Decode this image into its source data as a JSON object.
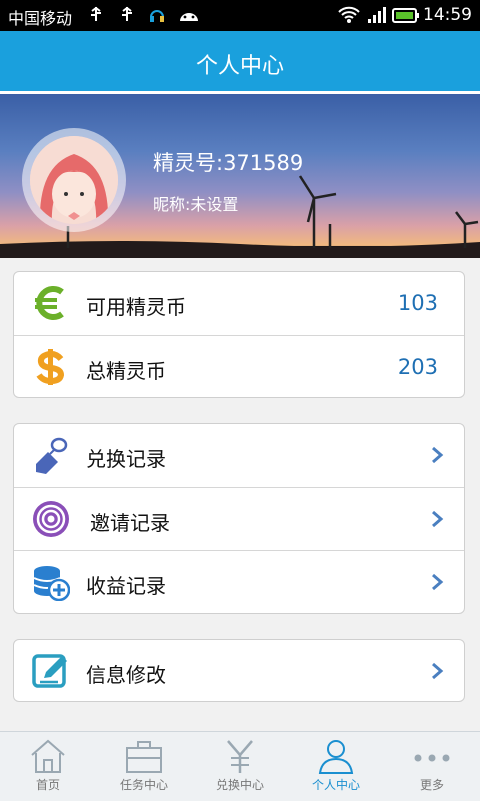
{
  "status_bar": {
    "carrier": "中国移动",
    "time": "14:59"
  },
  "header": {
    "title": "个人中心"
  },
  "profile": {
    "id_text": "精灵号:371589",
    "nickname_text": "昵称:未设置"
  },
  "balance": {
    "items": [
      {
        "label": "可用精灵币",
        "value": "103",
        "icon": "euro-icon"
      },
      {
        "label": "总精灵币",
        "value": "203",
        "icon": "dollar-icon"
      }
    ]
  },
  "records": {
    "items": [
      {
        "label": "兑换记录",
        "icon": "tag-icon"
      },
      {
        "label": "邀请记录",
        "icon": "broadcast-icon"
      },
      {
        "label": "收益记录",
        "icon": "coins-icon"
      }
    ]
  },
  "settings": {
    "items": [
      {
        "label": "信息修改",
        "icon": "edit-icon"
      }
    ]
  },
  "tabbar": {
    "tabs": [
      {
        "label": "首页",
        "icon": "home-icon"
      },
      {
        "label": "任务中心",
        "icon": "briefcase-icon"
      },
      {
        "label": "兑换中心",
        "icon": "yen-icon"
      },
      {
        "label": "个人中心",
        "icon": "person-icon"
      },
      {
        "label": "更多",
        "icon": "more-icon"
      }
    ],
    "active_index": 3
  },
  "colors": {
    "primary": "#1aa0dd",
    "value_blue": "#1e6fb3",
    "chevron": "#4a7fc0"
  }
}
